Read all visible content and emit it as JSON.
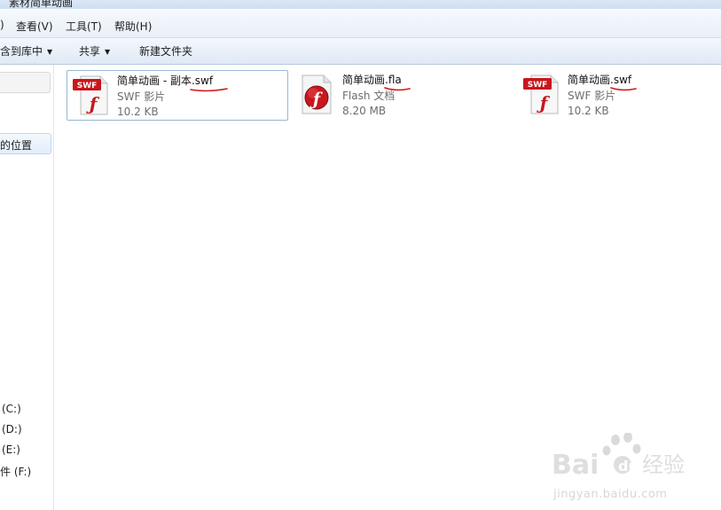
{
  "window": {
    "title": "素材简单动画"
  },
  "menubar": {
    "items": [
      {
        "label": ")"
      },
      {
        "label": "查看(V)"
      },
      {
        "label": "工具(T)"
      },
      {
        "label": "帮助(H)"
      }
    ]
  },
  "toolbar": {
    "include_library_label": "含到库中",
    "share_label": "共享",
    "new_folder_label": "新建文件夹"
  },
  "navpane": {
    "selected_label": "的位置",
    "drives": [
      {
        "label": "(C:)"
      },
      {
        "label": "(D:)"
      },
      {
        "label": "(E:)"
      },
      {
        "label": "件 (F:)"
      }
    ]
  },
  "files": [
    {
      "name": "简单动画 - 副本.swf",
      "type": "SWF 影片",
      "size": "10.2 KB",
      "icon": "swf-file-icon",
      "selected": true
    },
    {
      "name": "简单动画.fla",
      "type": "Flash 文档",
      "size": "8.20 MB",
      "icon": "fla-file-icon",
      "selected": false
    },
    {
      "name": "简单动画.swf",
      "type": "SWF 影片",
      "size": "10.2 KB",
      "icon": "swf-file-icon",
      "selected": false
    }
  ],
  "icons": {
    "swf_badge": "SWF"
  },
  "colors": {
    "swf_red": "#c8161d",
    "annotation_red": "#d11a1a",
    "selection_border": "#98b6d2"
  },
  "watermark": {
    "brand": "Bai du 经验",
    "url": "jingyan.baidu.com"
  }
}
